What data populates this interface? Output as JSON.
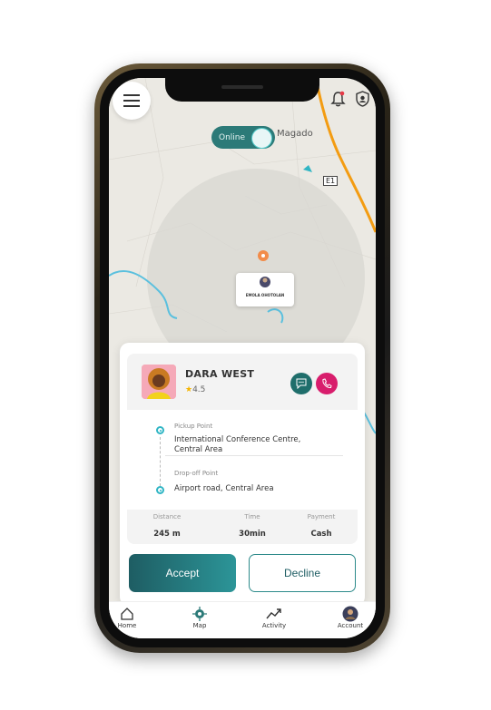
{
  "status": {
    "online_label": "Online"
  },
  "map": {
    "place_label": "Magado",
    "road_badge": "E1",
    "driver_pin_name": "EMOLA OHOTOLAN",
    "accent_route_color": "#f39c12"
  },
  "rider": {
    "name": "DARA WEST",
    "rating": "4.5"
  },
  "trip": {
    "pickup_label": "Pickup Point",
    "pickup_value_line1": "International Conference Centre,",
    "pickup_value_line2": "Central Area",
    "dropoff_label": "Drop-off Point",
    "dropoff_value": "Airport road, Central Area",
    "stats": [
      {
        "label": "Distance",
        "value": "245 m"
      },
      {
        "label": "Time",
        "value": "30min"
      },
      {
        "label": "Payment",
        "value": "Cash"
      }
    ]
  },
  "actions": {
    "accept_label": "Accept",
    "decline_label": "Decline"
  },
  "tabs": [
    {
      "label": "Home",
      "icon": "home-icon"
    },
    {
      "label": "Map",
      "icon": "map-icon"
    },
    {
      "label": "Activity",
      "icon": "activity-icon"
    },
    {
      "label": "Account",
      "icon": "account-icon"
    }
  ],
  "colors": {
    "brand": "#2c7a78",
    "call": "#d81d6c",
    "accent": "#2fb5c4"
  }
}
